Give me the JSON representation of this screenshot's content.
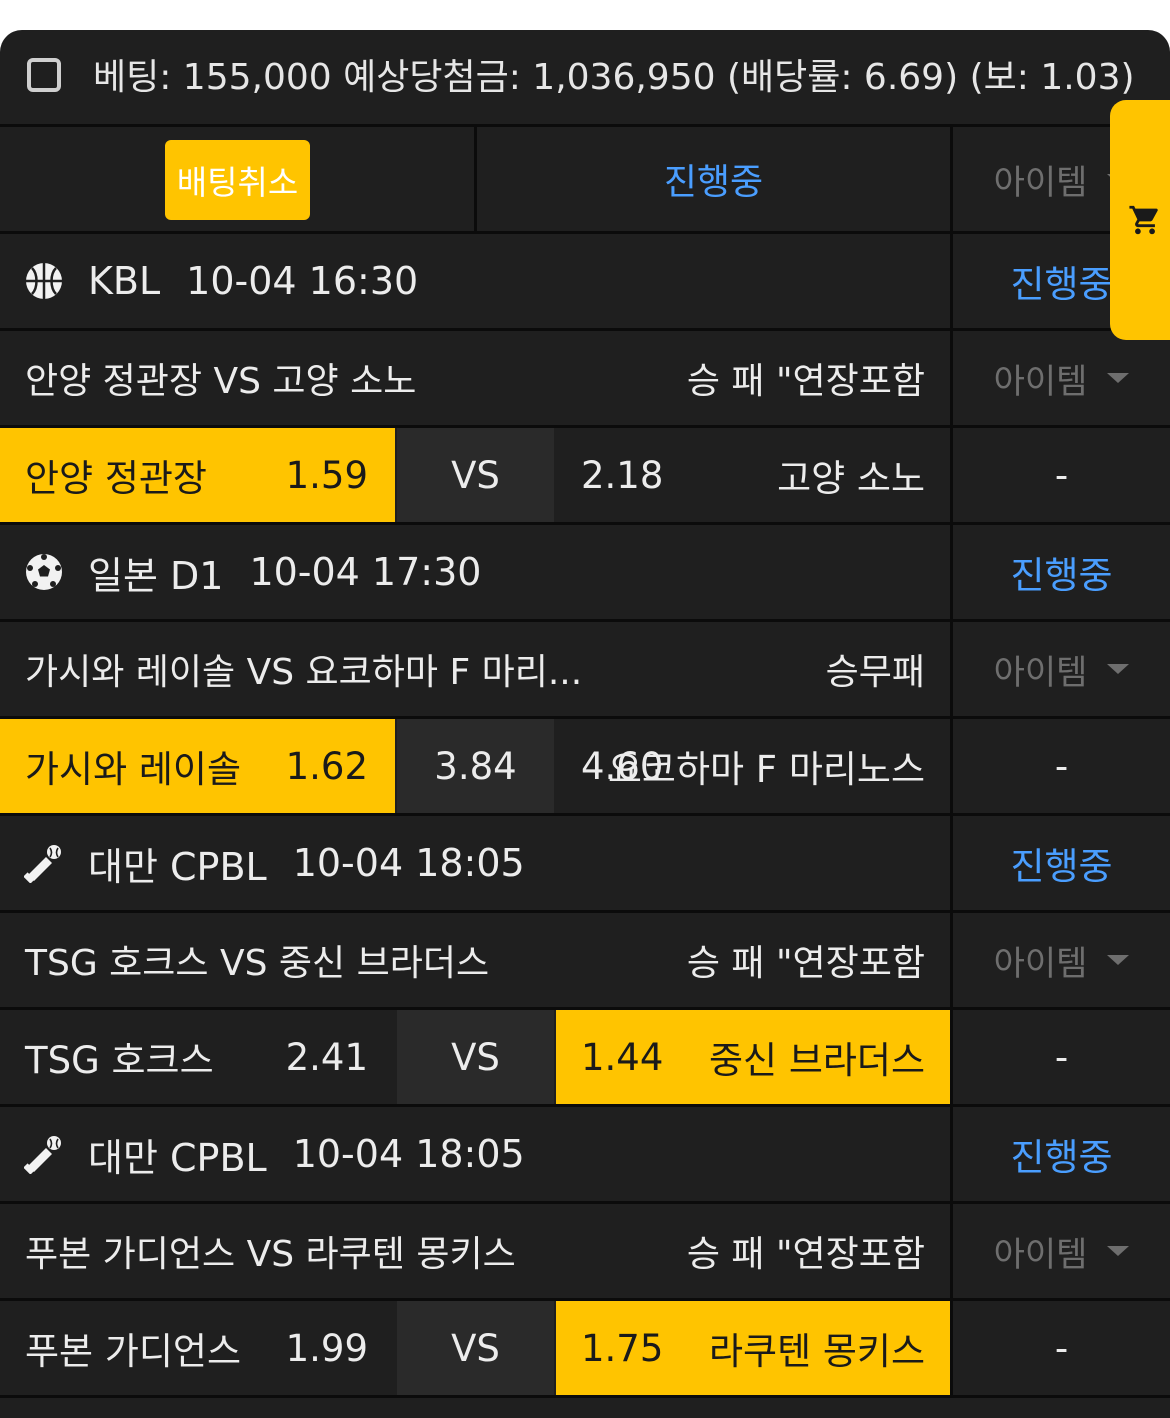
{
  "summary": "베팅: 155,000 예상당첨금: 1,036,950 (배당률: 6.69) (보: 1.03)",
  "header": {
    "cancel_label": "배팅취소",
    "progress_label": "진행중",
    "item_label": "아이템"
  },
  "games": [
    {
      "sport_icon": "basketball-icon",
      "league": "KBL",
      "datetime": "10-04 16:30",
      "status": "진행중",
      "match": "안양 정관장 VS 고양 소노",
      "market": "승 패 \"연장포함",
      "item": "아이템",
      "home": "안양 정관장",
      "home_odd": "1.59",
      "mid": "VS",
      "away_odd": "2.18",
      "away": "고양 소노",
      "selected": "home",
      "result": "-"
    },
    {
      "sport_icon": "soccer-ball-icon",
      "league": "일본 D1",
      "datetime": "10-04 17:30",
      "status": "진행중",
      "match": "가시와 레이솔 VS 요코하마 F 마리...",
      "market": "승무패",
      "item": "아이템",
      "home": "가시와 레이솔",
      "home_odd": "1.62",
      "mid": "3.84",
      "away_odd": "4.60",
      "away": "요코하마 F 마리노스",
      "selected": "home",
      "result": "-"
    },
    {
      "sport_icon": "baseball-icon",
      "league": "대만 CPBL",
      "datetime": "10-04 18:05",
      "status": "진행중",
      "match": "TSG 호크스 VS 중신 브라더스",
      "market": "승 패 \"연장포함",
      "item": "아이템",
      "home": "TSG 호크스",
      "home_odd": "2.41",
      "mid": "VS",
      "away_odd": "1.44",
      "away": "중신 브라더스",
      "selected": "away",
      "result": "-"
    },
    {
      "sport_icon": "baseball-icon",
      "league": "대만 CPBL",
      "datetime": "10-04 18:05",
      "status": "진행중",
      "match": "푸본 가디언스 VS 라쿠텐 몽키스",
      "market": "승 패 \"연장포함",
      "item": "아이템",
      "home": "푸본 가디언스",
      "home_odd": "1.99",
      "mid": "VS",
      "away_odd": "1.75",
      "away": "라쿠텐 몽키스",
      "selected": "away",
      "result": "-"
    }
  ],
  "colors": {
    "accent": "#ffc400",
    "link": "#4a9eff",
    "bg": "#1f1f1f"
  }
}
